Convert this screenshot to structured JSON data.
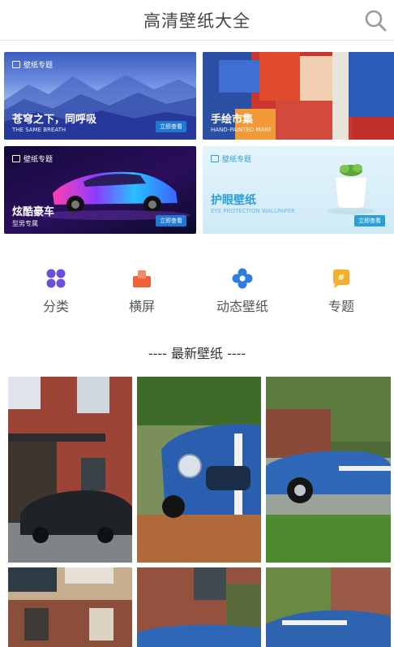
{
  "header": {
    "title": "高清壁纸大全"
  },
  "banners": [
    {
      "tag": "壁纸专题",
      "title": "苍穹之下，同呼吸",
      "subtitle": "THE SAME BREATH",
      "button": "立即查看"
    },
    {
      "tag": "",
      "title": "手绘市集",
      "subtitle": "HAND-PAINTED MART",
      "button": ""
    },
    {
      "tag": "壁纸专题",
      "title": "炫酷豪车",
      "subtitle": "型男专属",
      "button": "立即查看"
    },
    {
      "tag": "壁纸专题",
      "title": "护眼壁纸",
      "subtitle": "EYE PROTECTION WALLPAPER",
      "button": "立即查看"
    }
  ],
  "nav": [
    {
      "label": "分类",
      "icon": "category-icon",
      "color": "#6b4fd8"
    },
    {
      "label": "横屏",
      "icon": "landscape-icon",
      "color": "#f0603a"
    },
    {
      "label": "动态壁纸",
      "icon": "live-wallpaper-icon",
      "color": "#2f7de0"
    },
    {
      "label": "专题",
      "icon": "topic-icon",
      "color": "#f2b12b"
    }
  ],
  "section": {
    "title": "---- 最新壁纸 ----"
  },
  "colors": {
    "accent": "#1f78d1",
    "header_text": "#444444"
  }
}
